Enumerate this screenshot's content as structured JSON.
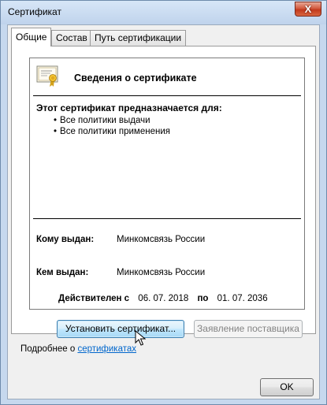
{
  "window": {
    "title": "Сертификат",
    "close_label": "X"
  },
  "tabs": [
    {
      "label": "Общие",
      "active": true
    },
    {
      "label": "Состав",
      "active": false
    },
    {
      "label": "Путь сертификации",
      "active": false
    }
  ],
  "info": {
    "title": "Сведения о сертификате",
    "purpose_title": "Этот сертификат предназначается для:",
    "purposes": [
      "Все политики выдачи",
      "Все политики применения"
    ],
    "issued_to_label": "Кому выдан:",
    "issued_to_value": "Минкомсвязь России",
    "issued_by_label": "Кем выдан:",
    "issued_by_value": "Минкомсвязь России",
    "valid_from_label": "Действителен с",
    "valid_from": "06. 07. 2018",
    "valid_to_label": "по",
    "valid_to": "01. 07. 2036"
  },
  "buttons": {
    "install": "Установить сертификат...",
    "issuer_statement": "Заявление поставщика",
    "ok": "OK"
  },
  "more": {
    "prefix": "Подробнее о",
    "link": "сертификатах"
  },
  "icons": {
    "certificate": "certificate-icon",
    "cursor": "mouse-cursor"
  },
  "colors": {
    "link": "#0066cc",
    "close_button": "#c2391d",
    "focus_button": "#3c7fb1"
  }
}
